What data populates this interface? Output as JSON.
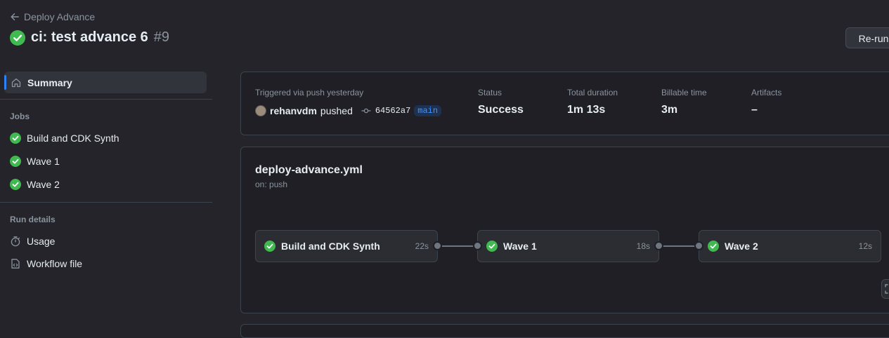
{
  "header": {
    "back_label": "Deploy Advance",
    "run_title": "ci: test advance 6",
    "run_number": "#9",
    "rerun_label": "Re-run"
  },
  "sidebar": {
    "summary_label": "Summary",
    "jobs_heading": "Jobs",
    "jobs": [
      {
        "label": "Build and CDK Synth",
        "status": "success"
      },
      {
        "label": "Wave 1",
        "status": "success"
      },
      {
        "label": "Wave 2",
        "status": "success"
      }
    ],
    "run_details_heading": "Run details",
    "details": [
      {
        "label": "Usage",
        "icon": "stopwatch-icon"
      },
      {
        "label": "Workflow file",
        "icon": "file-code-icon"
      }
    ]
  },
  "summary": {
    "trigger_label": "Triggered via push yesterday",
    "user": "rehanvdm",
    "action": "pushed",
    "commit": "64562a7",
    "branch": "main",
    "status_label": "Status",
    "status_value": "Success",
    "duration_label": "Total duration",
    "duration_value": "1m 13s",
    "billable_label": "Billable time",
    "billable_value": "3m",
    "artifacts_label": "Artifacts",
    "artifacts_value": "–"
  },
  "workflow": {
    "file": "deploy-advance.yml",
    "trigger": "on: push",
    "jobs": [
      {
        "name": "Build and CDK Synth",
        "duration": "22s"
      },
      {
        "name": "Wave 1",
        "duration": "18s"
      },
      {
        "name": "Wave 2",
        "duration": "12s"
      }
    ]
  },
  "colors": {
    "success": "#3fb950",
    "accent": "#2f81f7",
    "background": "#24242a"
  }
}
